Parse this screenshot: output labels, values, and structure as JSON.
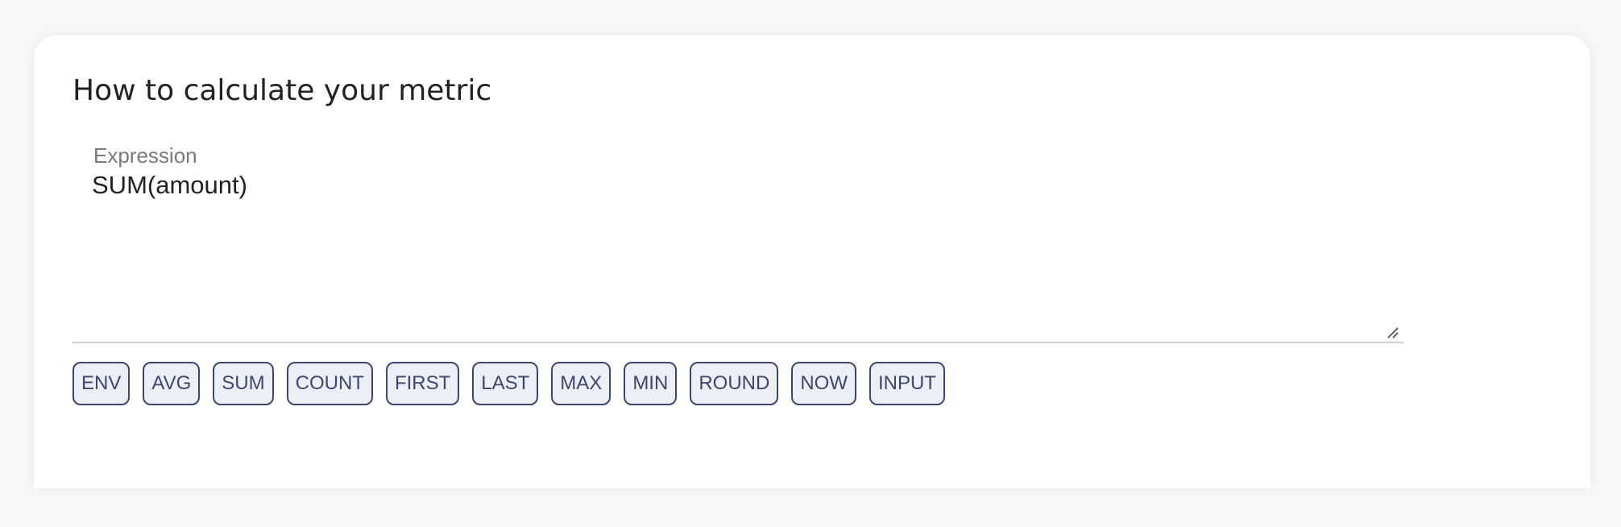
{
  "section": {
    "title": "How to calculate your metric"
  },
  "expression": {
    "label": "Expression",
    "value": "SUM(amount)"
  },
  "functions": [
    {
      "label": "ENV"
    },
    {
      "label": "AVG"
    },
    {
      "label": "SUM"
    },
    {
      "label": "COUNT"
    },
    {
      "label": "FIRST"
    },
    {
      "label": "LAST"
    },
    {
      "label": "MAX"
    },
    {
      "label": "MIN"
    },
    {
      "label": "ROUND"
    },
    {
      "label": "NOW"
    },
    {
      "label": "INPUT"
    }
  ],
  "colors": {
    "chip_border": "#3e466e",
    "chip_background": "#eceff5",
    "text": "#222222",
    "label": "#7a7a7a"
  },
  "icons": {
    "resize": "resize-handle-icon"
  }
}
